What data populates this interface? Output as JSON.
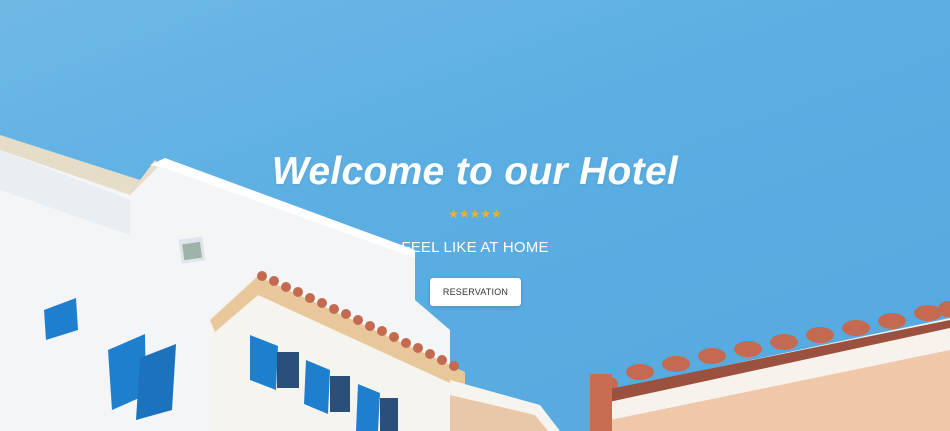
{
  "hero": {
    "title": "Welcome to our Hotel",
    "rating_stars": 5,
    "star_glyphs": [
      "★",
      "★",
      "★",
      "★",
      "★"
    ],
    "tagline": "FEEL LIKE AT HOME",
    "reservation_label": "RESERVATION"
  },
  "colors": {
    "sky": "#5aaee2",
    "star": "#f2b21c",
    "button_bg": "#ffffff",
    "shutter_blue": "#1f7fcf",
    "roof_tile": "#c46a50"
  }
}
